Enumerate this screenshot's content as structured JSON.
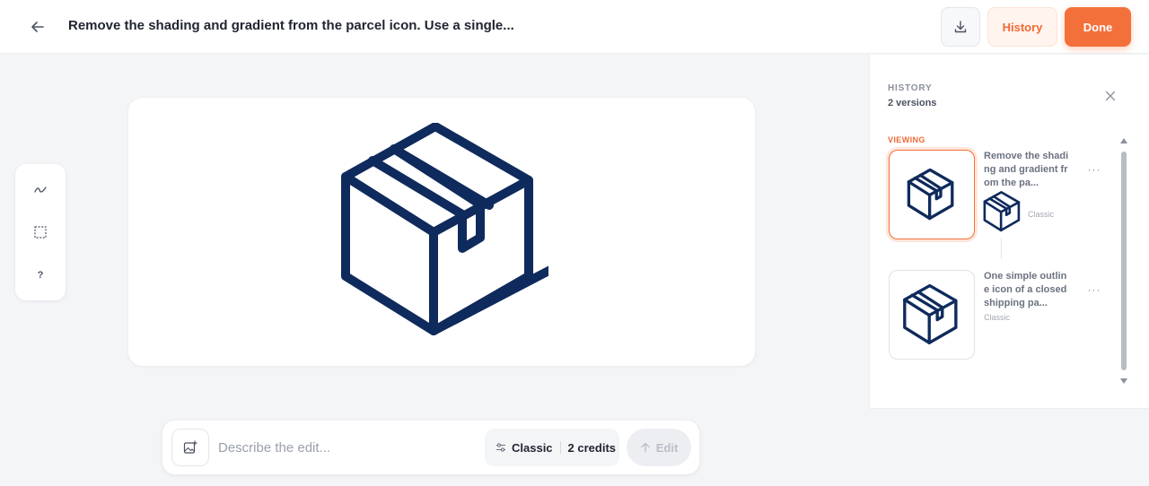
{
  "header": {
    "title": "Remove the shading and gradient from the parcel icon. Use a single...",
    "history_label": "History",
    "done_label": "Done"
  },
  "tools": [
    {
      "name": "brush-icon"
    },
    {
      "name": "select-rect-icon"
    },
    {
      "name": "help-icon",
      "label": "?"
    }
  ],
  "canvas": {
    "icon": "parcel-box-icon",
    "stroke_color": "#0f2a5c"
  },
  "prompt": {
    "placeholder": "Describe the edit...",
    "mode_label": "Classic",
    "credits_label": "2 credits",
    "edit_label": "Edit"
  },
  "history": {
    "title": "HISTORY",
    "count": "2 versions",
    "viewing_label": "VIEWING",
    "versions": [
      {
        "text": "Remove the shading and gradient from the pa...",
        "meta": "Classic",
        "active": true
      },
      {
        "text": "One simple outline icon of a closed shipping pa...",
        "meta": "Classic",
        "active": false
      }
    ]
  },
  "colors": {
    "accent": "#f4703b",
    "icon_navy": "#0f2a5c",
    "background": "#f4f5f7"
  }
}
